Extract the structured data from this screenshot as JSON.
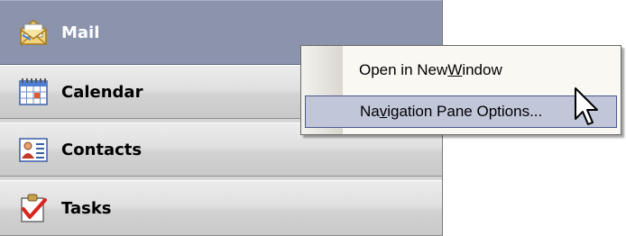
{
  "navigation_pane": {
    "buttons": [
      {
        "label": "Mail",
        "icon": "mail-envelope-icon",
        "selected": true
      },
      {
        "label": "Calendar",
        "icon": "calendar-icon",
        "selected": false
      },
      {
        "label": "Contacts",
        "icon": "contacts-card-icon",
        "selected": false
      },
      {
        "label": "Tasks",
        "icon": "tasks-checkmark-icon",
        "selected": false
      }
    ],
    "colors": {
      "selected_background": "#8b93ad",
      "button_background": "#d9d9d9"
    }
  },
  "context_menu": {
    "items": [
      {
        "before": "Open in New ",
        "mnemonic": "W",
        "after": "indow",
        "hover": false
      },
      {
        "before": "Na",
        "mnemonic": "v",
        "after": "igation Pane Options...",
        "hover": true
      }
    ],
    "colors": {
      "background": "#f9f8f3",
      "hover_background": "#c1c6d9",
      "hover_border": "#4b5a91"
    }
  },
  "cursor": {
    "icon": "arrow-pointer-icon"
  }
}
